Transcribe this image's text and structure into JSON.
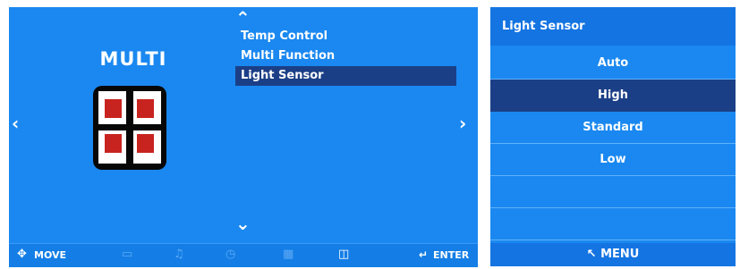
{
  "main_menu": {
    "category_label": "MULTI",
    "items": [
      {
        "label": "Temp Control"
      },
      {
        "label": "Multi Function"
      },
      {
        "label": "Light Sensor"
      }
    ],
    "selected_item": "Light Sensor",
    "bottom_bar": {
      "move_label": "MOVE",
      "enter_label": "ENTER",
      "icons": [
        "monitor-icon",
        "music-icon",
        "clock-icon",
        "grid-icon",
        "multi-icon"
      ]
    }
  },
  "submenu": {
    "title": "Light Sensor",
    "options": [
      {
        "label": "Auto"
      },
      {
        "label": "High"
      },
      {
        "label": "Standard"
      },
      {
        "label": "Low"
      },
      {
        "label": ""
      },
      {
        "label": ""
      }
    ],
    "selected_option": "High",
    "footer_label": "MENU"
  },
  "colors": {
    "panel_blue": "#1a88f0",
    "highlight_navy": "#1b3f86",
    "icon_red": "#c8241f"
  }
}
